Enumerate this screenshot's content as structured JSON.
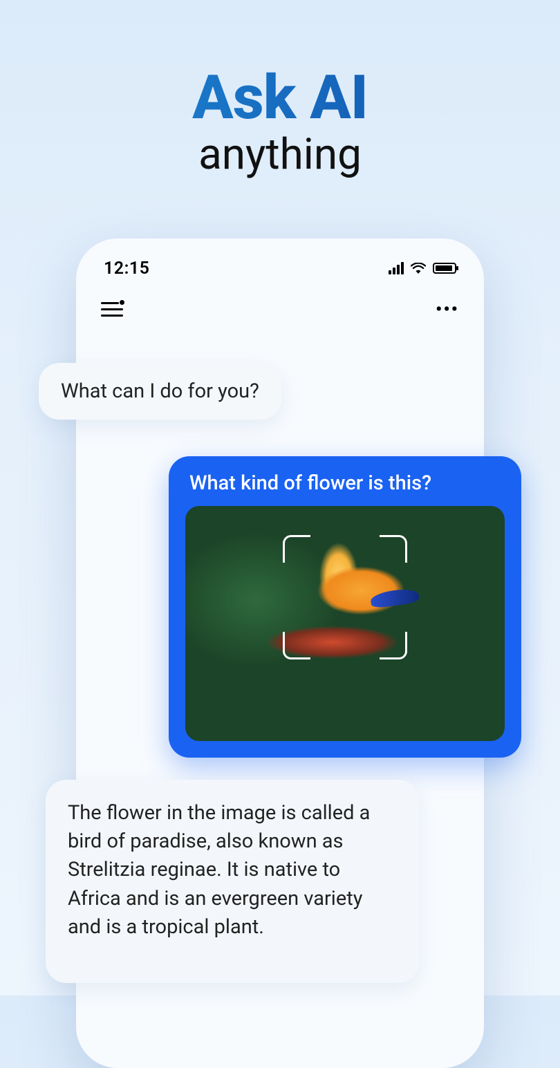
{
  "hero": {
    "title": "Ask AI",
    "subtitle": "anything"
  },
  "status": {
    "time": "12:15"
  },
  "chat": {
    "ai_greeting": "What can I do for you?",
    "user_question": "What kind of flower is this?",
    "ai_answer": "The flower in the image is called a bird of paradise, also known as Strelitzia reginae. It is native to Africa and is an evergreen variety and is a tropical plant."
  }
}
